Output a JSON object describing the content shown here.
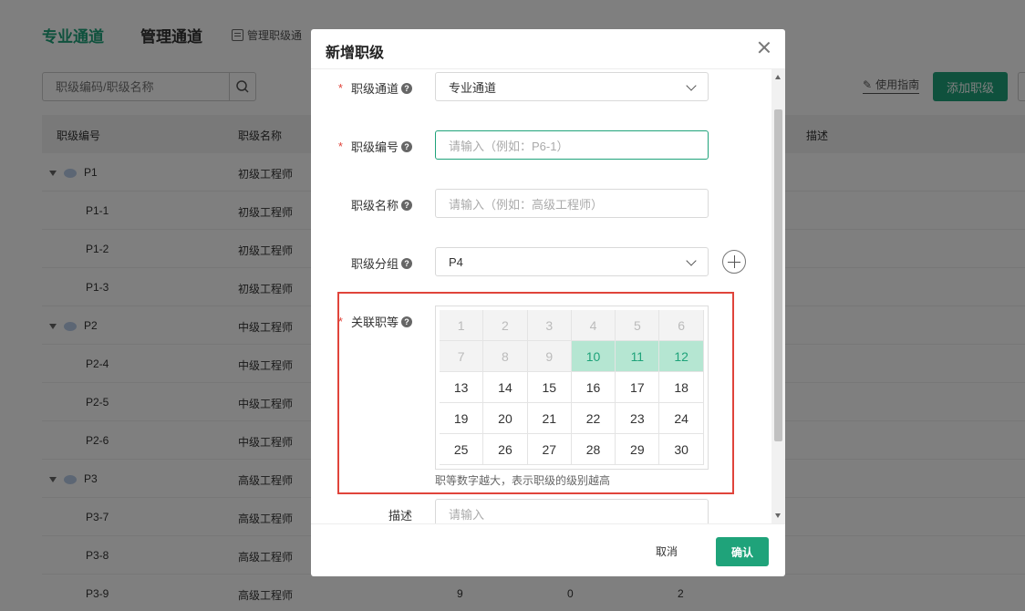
{
  "background": {
    "tabs": [
      "专业通道",
      "管理通道"
    ],
    "manage_link": "管理职级通",
    "search_placeholder": "职级编码/职级名称",
    "guide_link": "使用指南",
    "add_button": "添加职级",
    "columns": [
      "职级编号",
      "职级名称",
      "描述"
    ],
    "rows": [
      {
        "code": "P1",
        "name": "初级工程师",
        "group": true
      },
      {
        "code": "P1-1",
        "name": "初级工程师"
      },
      {
        "code": "P1-2",
        "name": "初级工程师"
      },
      {
        "code": "P1-3",
        "name": "初级工程师"
      },
      {
        "code": "P2",
        "name": "中级工程师",
        "group": true
      },
      {
        "code": "P2-4",
        "name": "中级工程师"
      },
      {
        "code": "P2-5",
        "name": "中级工程师"
      },
      {
        "code": "P2-6",
        "name": "中级工程师"
      },
      {
        "code": "P3",
        "name": "高级工程师",
        "group": true
      },
      {
        "code": "P3-7",
        "name": "高级工程师"
      },
      {
        "code": "P3-8",
        "name": "高级工程师"
      },
      {
        "code": "P3-9",
        "name": "高级工程师",
        "nums": [
          "9",
          "0",
          "2"
        ]
      }
    ]
  },
  "modal": {
    "title": "新增职级",
    "fields": {
      "channel": {
        "label": "职级通道",
        "value": "专业通道"
      },
      "code": {
        "label": "职级编号",
        "placeholder": "请输入（例如：P6-1）"
      },
      "name": {
        "label": "职级名称",
        "placeholder": "请输入（例如：高级工程师）"
      },
      "group": {
        "label": "职级分组",
        "value": "P4"
      },
      "grades": {
        "label": "关联职等",
        "hint": "职等数字越大，表示职级的级别越高"
      },
      "desc": {
        "label": "描述",
        "placeholder": "请输入"
      }
    },
    "grade_cells": [
      {
        "n": "1",
        "state": "disabled"
      },
      {
        "n": "2",
        "state": "disabled"
      },
      {
        "n": "3",
        "state": "disabled"
      },
      {
        "n": "4",
        "state": "disabled"
      },
      {
        "n": "5",
        "state": "disabled"
      },
      {
        "n": "6",
        "state": "disabled"
      },
      {
        "n": "7",
        "state": "disabled"
      },
      {
        "n": "8",
        "state": "disabled"
      },
      {
        "n": "9",
        "state": "disabled"
      },
      {
        "n": "10",
        "state": "selected"
      },
      {
        "n": "11",
        "state": "selected"
      },
      {
        "n": "12",
        "state": "selected"
      },
      {
        "n": "13",
        "state": "normal"
      },
      {
        "n": "14",
        "state": "normal"
      },
      {
        "n": "15",
        "state": "normal"
      },
      {
        "n": "16",
        "state": "normal"
      },
      {
        "n": "17",
        "state": "normal"
      },
      {
        "n": "18",
        "state": "normal"
      },
      {
        "n": "19",
        "state": "normal"
      },
      {
        "n": "20",
        "state": "normal"
      },
      {
        "n": "21",
        "state": "normal"
      },
      {
        "n": "22",
        "state": "normal"
      },
      {
        "n": "23",
        "state": "normal"
      },
      {
        "n": "24",
        "state": "normal"
      },
      {
        "n": "25",
        "state": "normal"
      },
      {
        "n": "26",
        "state": "normal"
      },
      {
        "n": "27",
        "state": "normal"
      },
      {
        "n": "28",
        "state": "normal"
      },
      {
        "n": "29",
        "state": "normal"
      },
      {
        "n": "30",
        "state": "normal"
      }
    ],
    "cancel": "取消",
    "confirm": "确认"
  },
  "colors": {
    "accent": "#1fa37a",
    "selected_bg": "#b5e6d2",
    "highlight": "#e0443b"
  }
}
